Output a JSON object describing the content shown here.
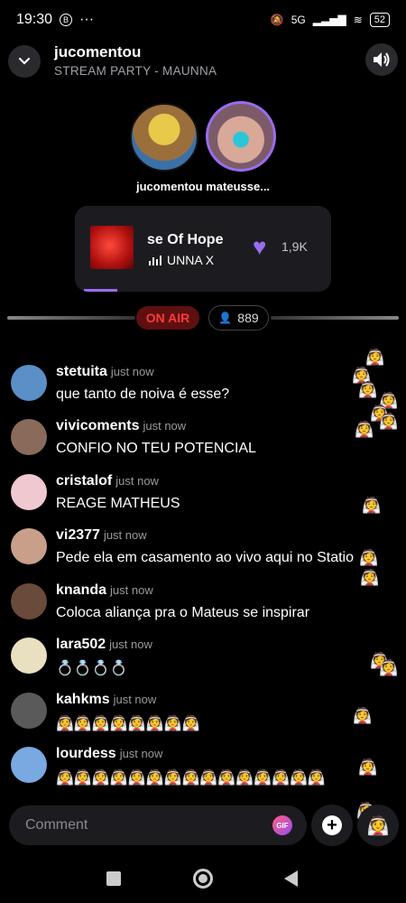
{
  "status": {
    "time": "19:30",
    "b_badge": "B",
    "dots": "···",
    "network": "5G",
    "battery": "52"
  },
  "header": {
    "title": "jucomentou",
    "subtitle": "STREAM PARTY - MAUNNA"
  },
  "participants": {
    "names": "jucomentou mateusse..."
  },
  "song": {
    "title": "se Of Hope",
    "artist": "UNNA X",
    "likes": "1,9K",
    "progress_fraction": 0.13
  },
  "live": {
    "on_air": "ON AIR",
    "viewers": "889"
  },
  "messages": [
    {
      "user": "stetuita",
      "time": "just now",
      "text": "que tanto de noiva é esse?",
      "avatar_color": "#5a8fc8"
    },
    {
      "user": "vivicoments",
      "time": "just now",
      "text": "CONFIO NO TEU POTENCIAL",
      "avatar_color": "#8a6a5a"
    },
    {
      "user": "cristalof",
      "time": "just now",
      "text": "REAGE MATHEUS",
      "avatar_color": "#f0c8d0"
    },
    {
      "user": "vi2377",
      "time": "just now",
      "text": "Pede ela em casamento ao vivo aqui no Statio",
      "avatar_color": "#c8a08a"
    },
    {
      "user": "knanda",
      "time": "just now",
      "text": "Coloca aliança pra o Mateus se inspirar",
      "avatar_color": "#6a4a3a"
    },
    {
      "user": "lara502",
      "time": "just now",
      "text": "💍💍💍💍",
      "avatar_color": "#e8e0c0"
    },
    {
      "user": "kahkms",
      "time": "just now",
      "text": "👰👰👰👰👰👰👰👰",
      "avatar_color": "#5a5a5a"
    },
    {
      "user": "lourdess",
      "time": "just now",
      "text": "👰👰👰👰👰👰👰👰👰👰👰👰👰👰👰",
      "avatar_color": "#7aa8e0"
    }
  ],
  "reaction_emoji": "👰",
  "comment": {
    "placeholder": "Comment",
    "gif_label": "GIF",
    "plus": "+"
  }
}
